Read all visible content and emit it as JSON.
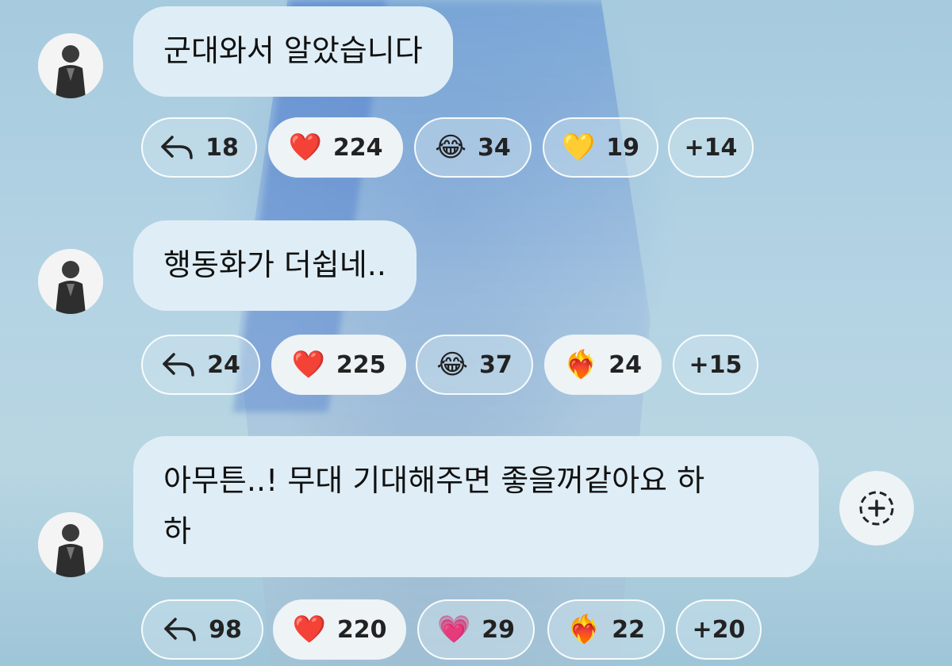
{
  "messages": [
    {
      "text": "군대와서 알았습니다",
      "reactions": {
        "reply": "18",
        "items": [
          {
            "icon": "red-heart-icon",
            "emoji": "❤️",
            "count": "224",
            "active": true
          },
          {
            "icon": "laughing-tears-icon",
            "emoji": "😂",
            "count": "34",
            "active": false
          },
          {
            "icon": "yellow-heart-icon",
            "emoji": "💛",
            "count": "19",
            "active": false
          }
        ],
        "more": "+14"
      }
    },
    {
      "text": "행동화가 더쉽네..",
      "reactions": {
        "reply": "24",
        "items": [
          {
            "icon": "red-heart-icon",
            "emoji": "❤️",
            "count": "225",
            "active": true
          },
          {
            "icon": "laughing-tears-icon",
            "emoji": "😂",
            "count": "37",
            "active": false
          },
          {
            "icon": "heart-on-fire-icon",
            "emoji": "❤️‍🔥",
            "count": "24",
            "active": true
          }
        ],
        "more": "+15"
      }
    },
    {
      "text_line1": "아무튼..! 무대 기대해주면 좋을꺼같아요 하",
      "text_line2": "하",
      "reactions": {
        "reply": "98",
        "items": [
          {
            "icon": "red-heart-icon",
            "emoji": "❤️",
            "count": "220",
            "active": true
          },
          {
            "icon": "pink-heart-icon",
            "emoji": "💗",
            "count": "29",
            "active": false
          },
          {
            "icon": "heart-on-fire-icon",
            "emoji": "❤️‍🔥",
            "count": "22",
            "active": false
          }
        ],
        "more": "+20"
      }
    }
  ],
  "colors": {
    "bubble": "#dfeef6",
    "chip_active": "#eef3f6",
    "text": "#111111"
  }
}
